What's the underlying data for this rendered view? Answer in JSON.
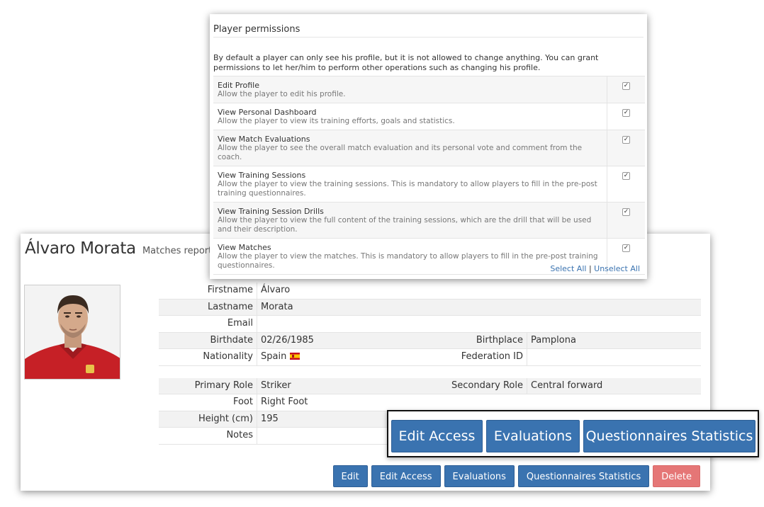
{
  "player": {
    "name": "Álvaro Morata",
    "subtitle": "Matches reports & stati"
  },
  "profile": {
    "firstname": {
      "label": "Firstname",
      "value": "Álvaro"
    },
    "lastname": {
      "label": "Lastname",
      "value": "Morata"
    },
    "email": {
      "label": "Email",
      "value": ""
    },
    "birthdate": {
      "label": "Birthdate",
      "value": "02/26/1985"
    },
    "birthplace": {
      "label": "Birthplace",
      "value": "Pamplona"
    },
    "nationality": {
      "label": "Nationality",
      "value": "Spain"
    },
    "federation_id": {
      "label": "Federation ID",
      "value": ""
    },
    "primary_role": {
      "label": "Primary Role",
      "value": "Striker"
    },
    "secondary_role": {
      "label": "Secondary Role",
      "value": "Central forward"
    },
    "foot": {
      "label": "Foot",
      "value": "Right Foot"
    },
    "height": {
      "label": "Height (cm)",
      "value": "195"
    },
    "notes": {
      "label": "Notes",
      "value": ""
    }
  },
  "actions": {
    "edit": "Edit",
    "edit_access": "Edit Access",
    "evaluations": "Evaluations",
    "questionnaires_statistics": "Questionnaires Statistics",
    "delete": "Delete"
  },
  "permissions": {
    "title": "Player permissions",
    "intro": "By default a player can only see his profile, but it is not allowed to change anything. You can grant permissions to let her/him to perform other operations such as changing his profile.",
    "items": [
      {
        "title": "Edit Profile",
        "desc": "Allow the player to edit his profile.",
        "checked": true
      },
      {
        "title": "View Personal Dashboard",
        "desc": "Allow the player to view its training efforts, goals and statistics.",
        "checked": true
      },
      {
        "title": "View Match Evaluations",
        "desc": "Allow the player to see the overall match evaluation and its personal vote and comment from the coach.",
        "checked": true
      },
      {
        "title": "View Training Sessions",
        "desc": "Allow the player to view the training sessions. This is mandatory to allow players to fill in the pre-post training questionnaires.",
        "checked": true
      },
      {
        "title": "View Training Session Drills",
        "desc": "Allow the player to view the full content of the training sessions, which are the drill that will be used and their description.",
        "checked": true
      },
      {
        "title": "View Matches",
        "desc": "Allow the player to view the matches. This is mandatory to allow players to fill in the pre-post training questionnaires.",
        "checked": true
      }
    ],
    "select_all": "Select All",
    "separator": "|",
    "unselect_all": "Unselect All"
  },
  "colors": {
    "primary": "#3a73b0",
    "danger": "#e57676"
  }
}
